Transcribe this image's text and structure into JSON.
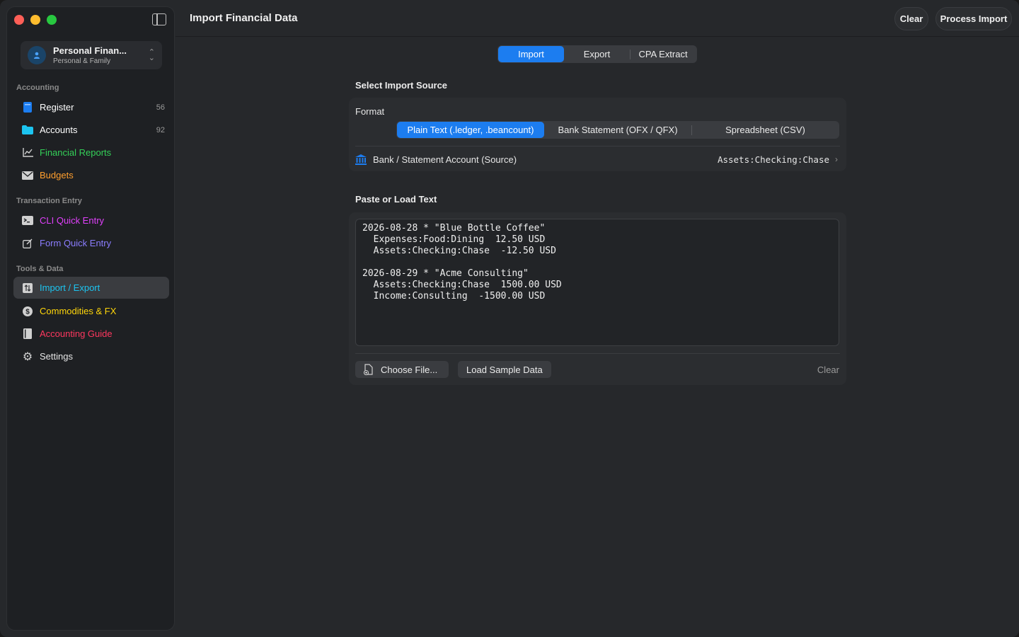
{
  "window": {
    "title": "Import Financial Data"
  },
  "header": {
    "clear_label": "Clear",
    "process_label": "Process Import"
  },
  "profile": {
    "name": "Personal Finan...",
    "subtitle": "Personal & Family",
    "icon": "person-icon"
  },
  "sidebar": {
    "sections": [
      {
        "title": "Accounting"
      },
      {
        "title": "Transaction Entry"
      },
      {
        "title": "Tools & Data"
      }
    ],
    "items": [
      {
        "label": "Register",
        "icon": "book-icon",
        "color": "#ffffff",
        "icon_color": "#1c7df0",
        "count": "56"
      },
      {
        "label": "Accounts",
        "icon": "folder-icon",
        "color": "#ffffff",
        "icon_color": "#1cc4f0",
        "count": "92"
      },
      {
        "label": "Financial Reports",
        "icon": "chart-line-icon",
        "color": "#34d058",
        "icon_color": "#d0d0d0"
      },
      {
        "label": "Budgets",
        "icon": "envelope-icon",
        "color": "#ff9f2e",
        "icon_color": "#d0d0d0"
      },
      {
        "label": "CLI Quick Entry",
        "icon": "terminal-icon",
        "color": "#e040fb",
        "icon_color": "#d0d0d0"
      },
      {
        "label": "Form Quick Entry",
        "icon": "edit-icon",
        "color": "#8b7dff",
        "icon_color": "#d0d0d0"
      },
      {
        "label": "Import / Export",
        "icon": "import-export-icon",
        "color": "#1cc4f0",
        "icon_color": "#d0d0d0",
        "active": true
      },
      {
        "label": "Commodities & FX",
        "icon": "dollar-circle-icon",
        "color": "#ffd60a",
        "icon_color": "#d0d0d0"
      },
      {
        "label": "Accounting Guide",
        "icon": "guide-book-icon",
        "color": "#ff375f",
        "icon_color": "#d0d0d0"
      },
      {
        "label": "Settings",
        "icon": "gear-icon",
        "color": "#e6e6e6",
        "icon_color": "#d0d0d0"
      }
    ]
  },
  "tabs": [
    {
      "label": "Import",
      "active": true
    },
    {
      "label": "Export"
    },
    {
      "label": "CPA Extract"
    }
  ],
  "import_source": {
    "heading": "Select Import Source",
    "format_label": "Format",
    "formats": [
      {
        "label": "Plain Text (.ledger, .beancount)",
        "active": true
      },
      {
        "label": "Bank Statement (OFX / QFX)"
      },
      {
        "label": "Spreadsheet (CSV)"
      }
    ],
    "account_label": "Bank / Statement Account (Source)",
    "account_value": "Assets:Checking:Chase"
  },
  "paste": {
    "heading": "Paste or Load Text",
    "text": "2026-08-28 * \"Blue Bottle Coffee\"\n  Expenses:Food:Dining  12.50 USD\n  Assets:Checking:Chase  -12.50 USD\n\n2026-08-29 * \"Acme Consulting\"\n  Assets:Checking:Chase  1500.00 USD\n  Income:Consulting  -1500.00 USD",
    "choose_file_label": "Choose File...",
    "sample_label": "Load Sample Data",
    "clear_label": "Clear"
  },
  "colors": {
    "accent": "#1c7df0"
  }
}
